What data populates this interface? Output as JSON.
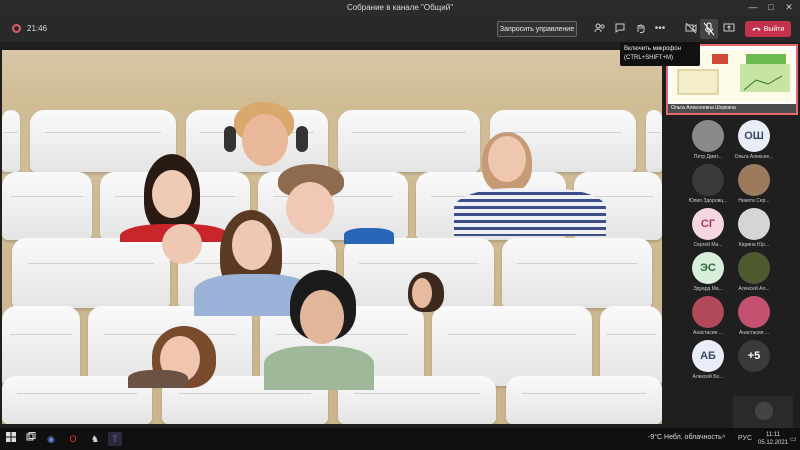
{
  "window": {
    "title": "Собрание в канале \"Общий\"",
    "minimize": "—",
    "maximize": "□",
    "close": "✕"
  },
  "toolbar": {
    "timer": "21:46",
    "request_control": "Запросить управление",
    "more": "•••",
    "leave": "Выйти"
  },
  "tooltip": {
    "line1": "Включить микрофон",
    "line2": "(CTRL+SHIFT+M)"
  },
  "presenter": {
    "name": "Ольга Алексеевна Шоркина"
  },
  "participants": [
    {
      "name": "Петр Дмит...",
      "initials": "",
      "avatar_color": "#8a8a8a"
    },
    {
      "name": "Ольга Алексее...",
      "initials": "ОШ",
      "avatar_color": "#e8edf7",
      "initials_color": "#3b4a6b"
    },
    {
      "name": "Юлия Здоровц...",
      "initials": "",
      "avatar_color": "#3a3a3a"
    },
    {
      "name": "Никита Сер...",
      "initials": "",
      "avatar_color": "#9c7a5c"
    },
    {
      "name": "Сергей Ма...",
      "initials": "СГ",
      "avatar_color": "#f6d6df",
      "initials_color": "#a33a5a"
    },
    {
      "name": "Карина Юр...",
      "initials": "",
      "avatar_color": "#d5d5d5"
    },
    {
      "name": "Эдуард Ма...",
      "initials": "ЭС",
      "avatar_color": "#d8efdc",
      "initials_color": "#2f6b3c"
    },
    {
      "name": "Алексей Ал...",
      "initials": "",
      "avatar_color": "#4d5a2e"
    },
    {
      "name": "Анастасия ...",
      "initials": "",
      "avatar_color": "#b04a5a"
    },
    {
      "name": "Анастасия ...",
      "initials": "",
      "avatar_color": "#c45070"
    },
    {
      "name": "Алексей Бо...",
      "initials": "АБ",
      "avatar_color": "#e8edf7",
      "initials_color": "#3b4a6b"
    },
    {
      "name": "",
      "initials": "+5",
      "avatar_color": "#3a3a3a",
      "initials_color": "#ffffff"
    }
  ],
  "taskbar": {
    "weather": "-9°С  Небл. облачность",
    "time": "11:11",
    "date": "05.12.2021",
    "lang": "РУС"
  },
  "colors": {
    "leave": "#c4314b",
    "presenter_border": "#e66a6a",
    "background": "#1f1f1f"
  }
}
